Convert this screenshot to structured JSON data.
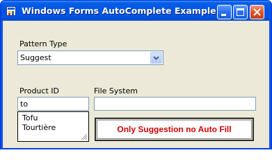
{
  "window": {
    "title": "Windows Forms AutoComplete Example"
  },
  "titlebar_buttons": {
    "minimize": "minimize",
    "maximize": "maximize",
    "close": "close"
  },
  "pattern_type": {
    "label": "Pattern Type",
    "selected": "Suggest"
  },
  "product_id": {
    "label": "Product ID",
    "value": "to",
    "suggestions": [
      "Tofu",
      "Tourtière"
    ]
  },
  "file_system": {
    "label": "File System",
    "value": ""
  },
  "status": {
    "text": "Only Suggestion no Auto Fill",
    "color": "#d40000"
  },
  "icons": [
    "form-app-icon",
    "minimize-icon",
    "maximize-icon",
    "close-icon",
    "dropdown-arrow-icon",
    "resize-grip-icon"
  ]
}
